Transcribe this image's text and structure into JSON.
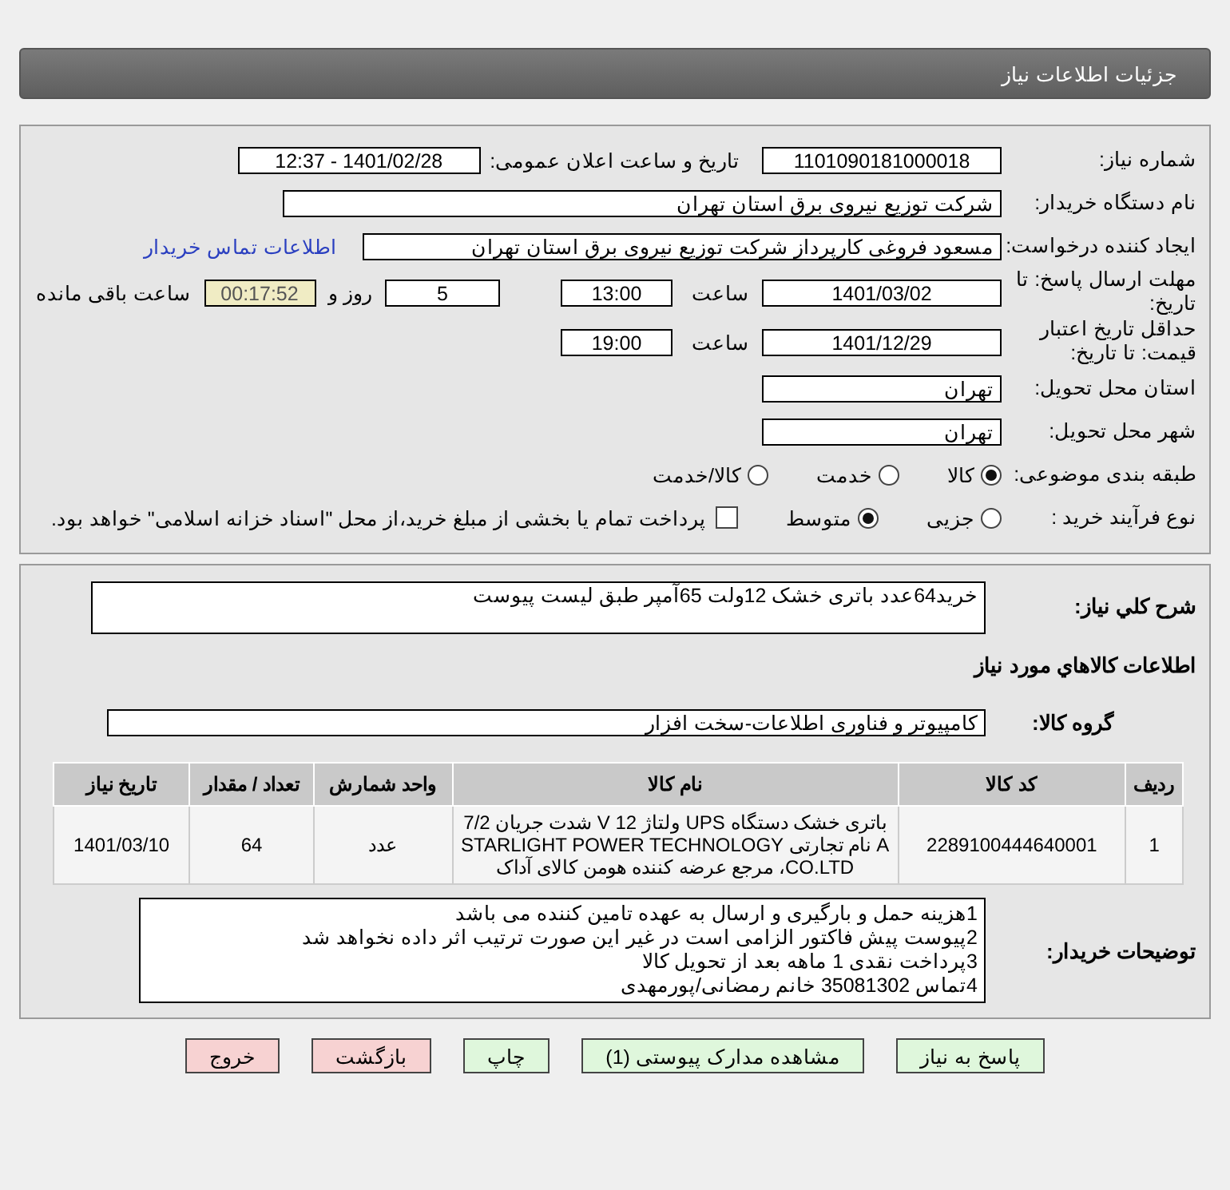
{
  "header": {
    "title": "جزئیات اطلاعات نیاز"
  },
  "details": {
    "need_number": {
      "label": "شماره نیاز:",
      "value": "1101090181000018"
    },
    "announce": {
      "label": "تاریخ و ساعت اعلان عمومی:",
      "value": "1401/02/28 - 12:37"
    },
    "buyer_org": {
      "label": "نام دستگاه خریدار:",
      "value": "شرکت توزیع نیروی برق استان تهران"
    },
    "creator": {
      "label": "ایجاد کننده درخواست:",
      "value": "مسعود فروغی کارپرداز شرکت توزیع نیروی برق استان تهران",
      "link": "اطلاعات تماس خریدار"
    },
    "deadline": {
      "label": "مهلت ارسال پاسخ: تا تاریخ:",
      "date": "1401/03/02",
      "time_label": "ساعت",
      "time": "13:00",
      "days": "5",
      "days_label": "روز و",
      "remaining": "00:17:52",
      "remaining_label": "ساعت باقی مانده"
    },
    "validity": {
      "label": "حداقل تاریخ اعتبار قیمت: تا تاریخ:",
      "date": "1401/12/29",
      "time_label": "ساعت",
      "time": "19:00"
    },
    "province": {
      "label": "استان محل تحویل:",
      "value": "تهران"
    },
    "city": {
      "label": "شهر محل تحویل:",
      "value": "تهران"
    },
    "category": {
      "label": "طبقه بندی موضوعی:",
      "options": [
        {
          "label": "کالا",
          "selected": true
        },
        {
          "label": "خدمت",
          "selected": false
        },
        {
          "label": "کالا/خدمت",
          "selected": false
        }
      ]
    },
    "process": {
      "label": "نوع فرآیند خرید :",
      "options": [
        {
          "label": "جزیی",
          "selected": false
        },
        {
          "label": "متوسط",
          "selected": true
        }
      ],
      "payment": {
        "label": "پرداخت تمام یا بخشی از مبلغ خرید،از محل \"اسناد خزانه اسلامی\" خواهد بود.",
        "checked": false
      }
    }
  },
  "summary": {
    "description": {
      "label": "شرح کلي نياز:",
      "value": "خرید64عدد باتری خشک 12ولت 65آمپر طبق لیست پیوست"
    },
    "goods_title": "اطلاعات کالاهاي مورد نياز",
    "group": {
      "label": "گروه کالا:",
      "value": "کامپیوتر و فناوری اطلاعات-سخت افزار"
    },
    "table": {
      "columns": [
        "ردیف",
        "کد کالا",
        "نام کالا",
        "واحد شمارش",
        "تعداد / مقدار",
        "تاریخ نیاز"
      ],
      "rows": [
        [
          "1",
          "2289100444640001",
          "باتری خشک دستگاه UPS ولتاژ 12 V شدت جریان 7/2 A نام تجارتی STARLIGHT POWER TECHNOLOGY CO.LTD، مرجع عرضه کننده هومن کالای آداک",
          "عدد",
          "64",
          "1401/03/10"
        ]
      ]
    },
    "notes": {
      "label": "توضیحات خریدار:",
      "lines": [
        "1هزینه حمل و بارگیری و ارسال به عهده تامین کننده می باشد",
        "2پیوست پیش فاکتور الزامی است در غیر این صورت ترتیب اثر داده نخواهد شد",
        "3پرداخت نقدی 1 ماهه بعد از تحویل کالا",
        "4تماس 35081302 خانم رمضانی/پورمهدی"
      ]
    }
  },
  "buttons": [
    {
      "label": "پاسخ به نیاز",
      "kind": "primary"
    },
    {
      "label": "مشاهده مدارک پیوستی (1)",
      "kind": "primary"
    },
    {
      "label": "چاپ",
      "kind": "primary"
    },
    {
      "label": "بازگشت",
      "kind": "danger"
    },
    {
      "label": "خروج",
      "kind": "danger"
    }
  ]
}
